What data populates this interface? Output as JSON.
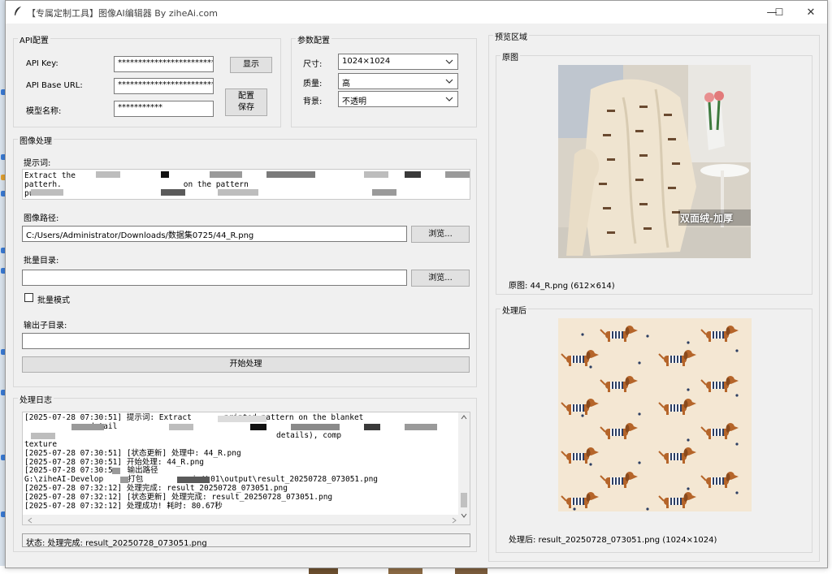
{
  "window": {
    "title": "【专属定制工具】图像AI编辑器 By ziheAi.com",
    "minimize": "—",
    "maximize": "☐",
    "close": "✕"
  },
  "api": {
    "group_label": "API配置",
    "key_label": "API Key:",
    "key_value": "****************************",
    "base_label": "API Base URL:",
    "base_value": "*************************",
    "model_label": "模型名称:",
    "model_value": "***********",
    "show_button": "显示",
    "save_button": "配置\n保存"
  },
  "params": {
    "group_label": "参数配置",
    "size_label": "尺寸:",
    "size_value": "1024×1024",
    "quality_label": "质量:",
    "quality_value": "高",
    "background_label": "背景:",
    "background_value": "不透明"
  },
  "process": {
    "group_label": "图像处理",
    "prompt_label": "提示词:",
    "prompt_line1": "Extract the",
    "prompt_line2a": "patterh.",
    "prompt_line2b": "on the pattern",
    "prompt_line3": "pu",
    "image_path_label": "图像路径:",
    "image_path_value": "C:/Users/Administrator/Downloads/数据集0725/44_R.png",
    "browse_button": "浏览...",
    "batch_dir_label": "批量目录:",
    "batch_dir_value": "",
    "batch_browse_button": "浏览...",
    "batch_mode_label": "批量模式",
    "output_subdir_label": "输出子目录:",
    "output_subdir_value": "",
    "start_button": "开始处理"
  },
  "log": {
    "group_label": "处理日志",
    "lines": [
      "[2025-07-28 07:30:51] 提示词: Extract",
      "",
      "",
      "texture",
      "[2025-07-28 07:30:51] [状态更新] 处理中: 44_R.png",
      "[2025-07-28 07:30:51] 开始处理: 44_R.png",
      "[2025-07-28 07:30:5",
      "G:\\ziheAI-Develop",
      "[2025-07-28 07:32:12] 处理完成: result_20250728_073051.png",
      "[2025-07-28 07:32:12] [状态更新] 处理完成: result_20250728_073051.png",
      "[2025-07-28 07:32:12] 处理成功! 耗时: 80.67秒"
    ],
    "frag_line1": "printed pattern on the blanket",
    "frag_line2": "detail",
    "frag_line3": "details), comp",
    "frag_line7": "输出路径",
    "frag_line8a": "打包",
    "frag_line8b": "ist\\01\\output\\result_20250728_073051.png",
    "status": "状态: 处理完成: result_20250728_073051.png"
  },
  "preview": {
    "group_label": "预览区域",
    "original_label": "原图",
    "original_caption": "原图: 44_R.png (612×614)",
    "original_overlay": "双面绒-加厚",
    "processed_label": "处理后",
    "processed_caption": "处理后: result_20250728_073051.png (1024×1024)"
  },
  "colors": {
    "window_bg": "#f0f0f0",
    "pattern_bg": "#f4e7d3",
    "dog_brown": "#b5652a",
    "stripe_navy": "#2c3e63"
  }
}
